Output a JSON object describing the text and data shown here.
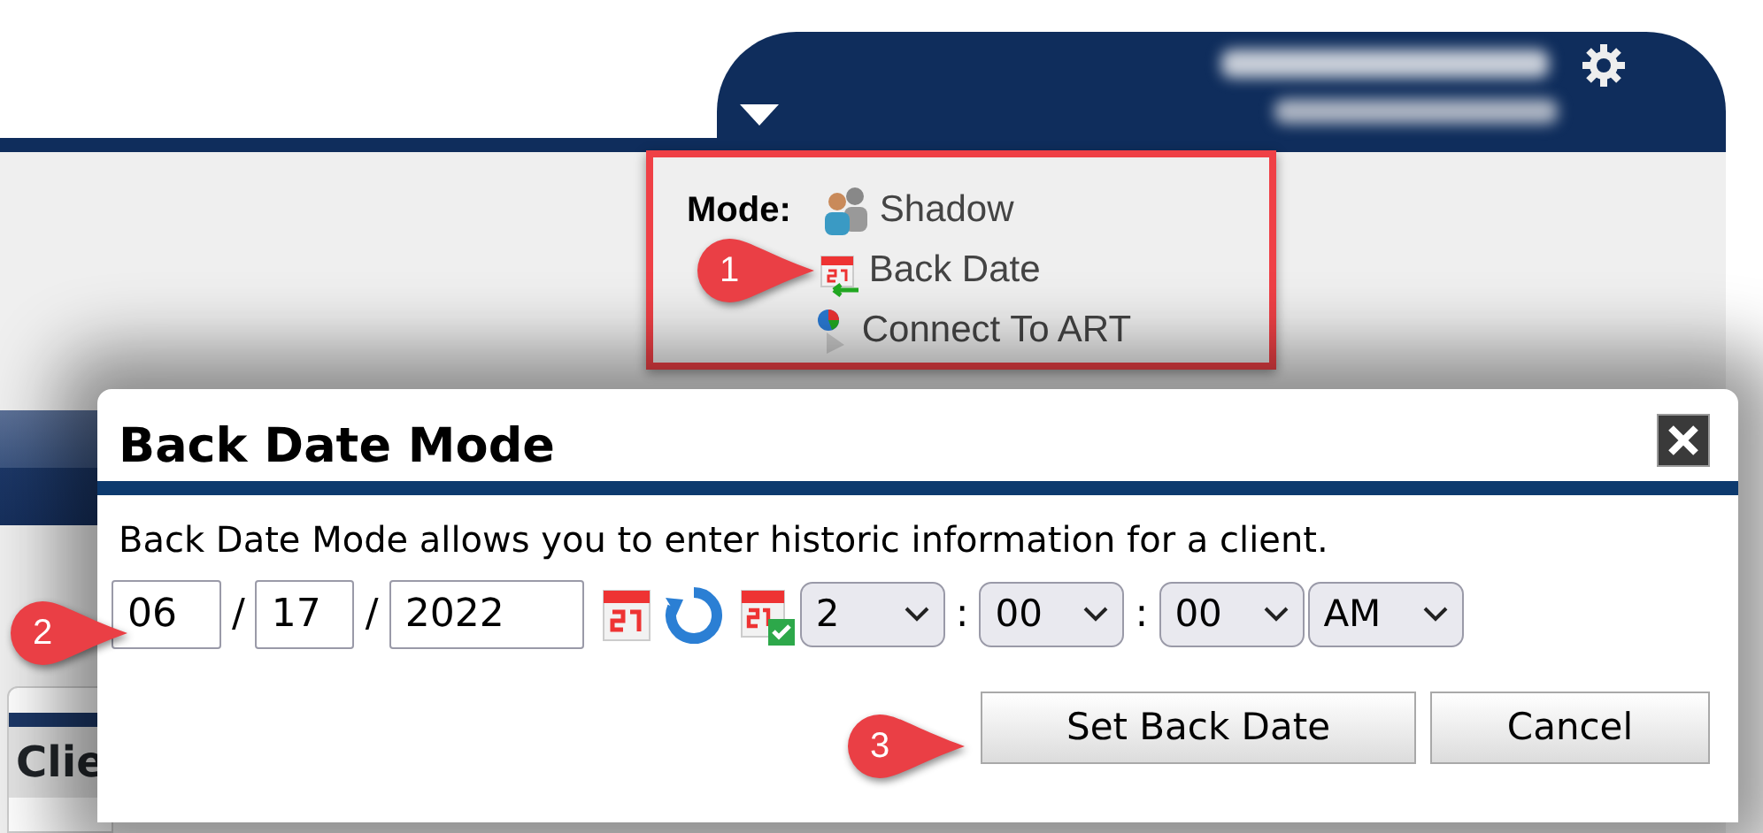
{
  "mode_panel": {
    "label": "Mode:",
    "items": [
      {
        "kind": "shadow",
        "label": "Shadow"
      },
      {
        "kind": "back_date",
        "label": "Back Date"
      },
      {
        "kind": "art",
        "label": "Connect To ART"
      }
    ]
  },
  "background_table": {
    "header_cell": "Clie"
  },
  "dialog": {
    "title": "Back Date Mode",
    "description": "Back Date Mode allows you to enter historic information for a client.",
    "date": {
      "fields": [
        "06",
        "17",
        "2022"
      ],
      "separators": [
        "/",
        "/"
      ]
    },
    "time": {
      "selects": [
        "2",
        "00",
        "00",
        "AM"
      ],
      "separators": [
        ":",
        ":"
      ]
    },
    "buttons": [
      "Set Back Date",
      "Cancel"
    ]
  },
  "callouts": [
    {
      "number": "1"
    },
    {
      "number": "2"
    },
    {
      "number": "3"
    }
  ]
}
